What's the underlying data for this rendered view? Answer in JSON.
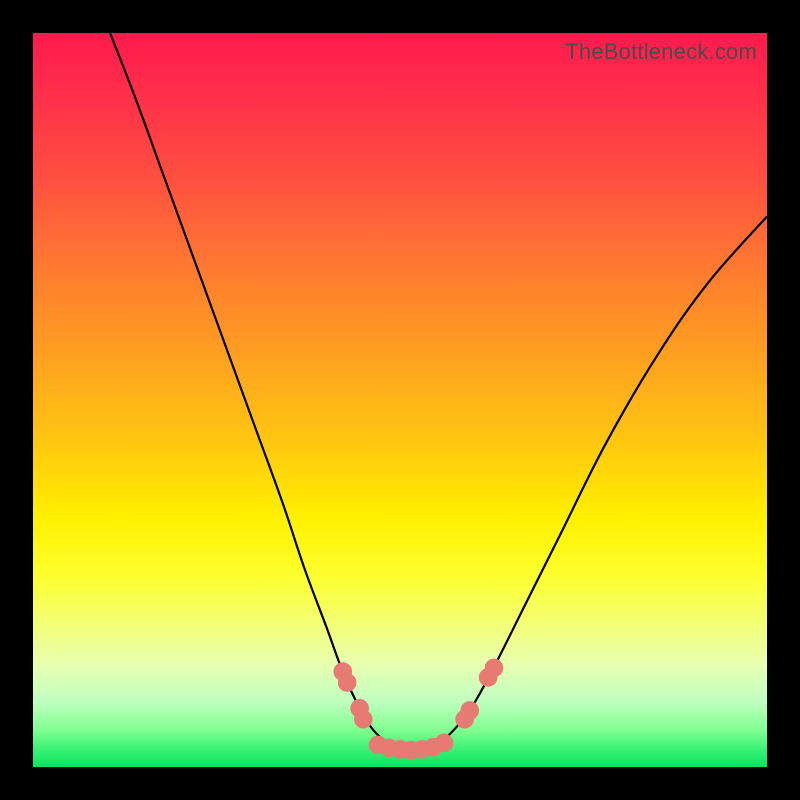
{
  "watermark": "TheBottleneck.com",
  "colors": {
    "frame": "#000000",
    "curve": "#000000",
    "marker": "#e77a72",
    "gradient_top": "#ff1a4d",
    "gradient_bottom": "#10e060"
  },
  "chart_data": {
    "type": "line",
    "title": "",
    "xlabel": "",
    "ylabel": "",
    "xlim": [
      0,
      100
    ],
    "ylim": [
      0,
      100
    ],
    "grid": false,
    "legend": false,
    "note": "A bottleneck-style V-curve over a vertical red→green gradient. The curve falls steeply from upper-left, reaches a wide flat minimum near the bottom around x≈45–58, and rises again to mid-right height. Pink markers sit on the curve near the trough and on both sides of it. Values are read off in plot-area percentage coordinates (0,0 = top-left; y increases downward).",
    "series": [
      {
        "name": "bottleneck-curve",
        "points_xy_pct": [
          [
            10.5,
            0.0
          ],
          [
            14.0,
            9.0
          ],
          [
            18.0,
            20.0
          ],
          [
            22.0,
            31.0
          ],
          [
            26.0,
            42.0
          ],
          [
            30.0,
            53.0
          ],
          [
            34.0,
            64.0
          ],
          [
            37.0,
            73.0
          ],
          [
            40.0,
            81.0
          ],
          [
            42.0,
            86.5
          ],
          [
            44.0,
            91.0
          ],
          [
            46.0,
            94.5
          ],
          [
            48.0,
            96.5
          ],
          [
            50.0,
            97.5
          ],
          [
            52.0,
            97.7
          ],
          [
            54.0,
            97.4
          ],
          [
            56.0,
            96.2
          ],
          [
            58.0,
            94.2
          ],
          [
            60.0,
            91.5
          ],
          [
            63.0,
            86.0
          ],
          [
            67.0,
            78.0
          ],
          [
            72.0,
            68.0
          ],
          [
            78.0,
            56.0
          ],
          [
            85.0,
            44.0
          ],
          [
            92.0,
            34.0
          ],
          [
            100.0,
            25.0
          ]
        ]
      }
    ],
    "markers_xy_pct": [
      [
        42.2,
        87.0
      ],
      [
        42.8,
        88.5
      ],
      [
        44.5,
        92.0
      ],
      [
        45.0,
        93.5
      ],
      [
        47.0,
        97.0
      ],
      [
        48.5,
        97.4
      ],
      [
        50.0,
        97.6
      ],
      [
        51.5,
        97.7
      ],
      [
        53.0,
        97.6
      ],
      [
        54.5,
        97.3
      ],
      [
        56.0,
        96.7
      ],
      [
        58.8,
        93.5
      ],
      [
        59.5,
        92.3
      ],
      [
        62.0,
        87.8
      ],
      [
        62.8,
        86.5
      ]
    ],
    "marker_radius_pct": 1.2
  }
}
